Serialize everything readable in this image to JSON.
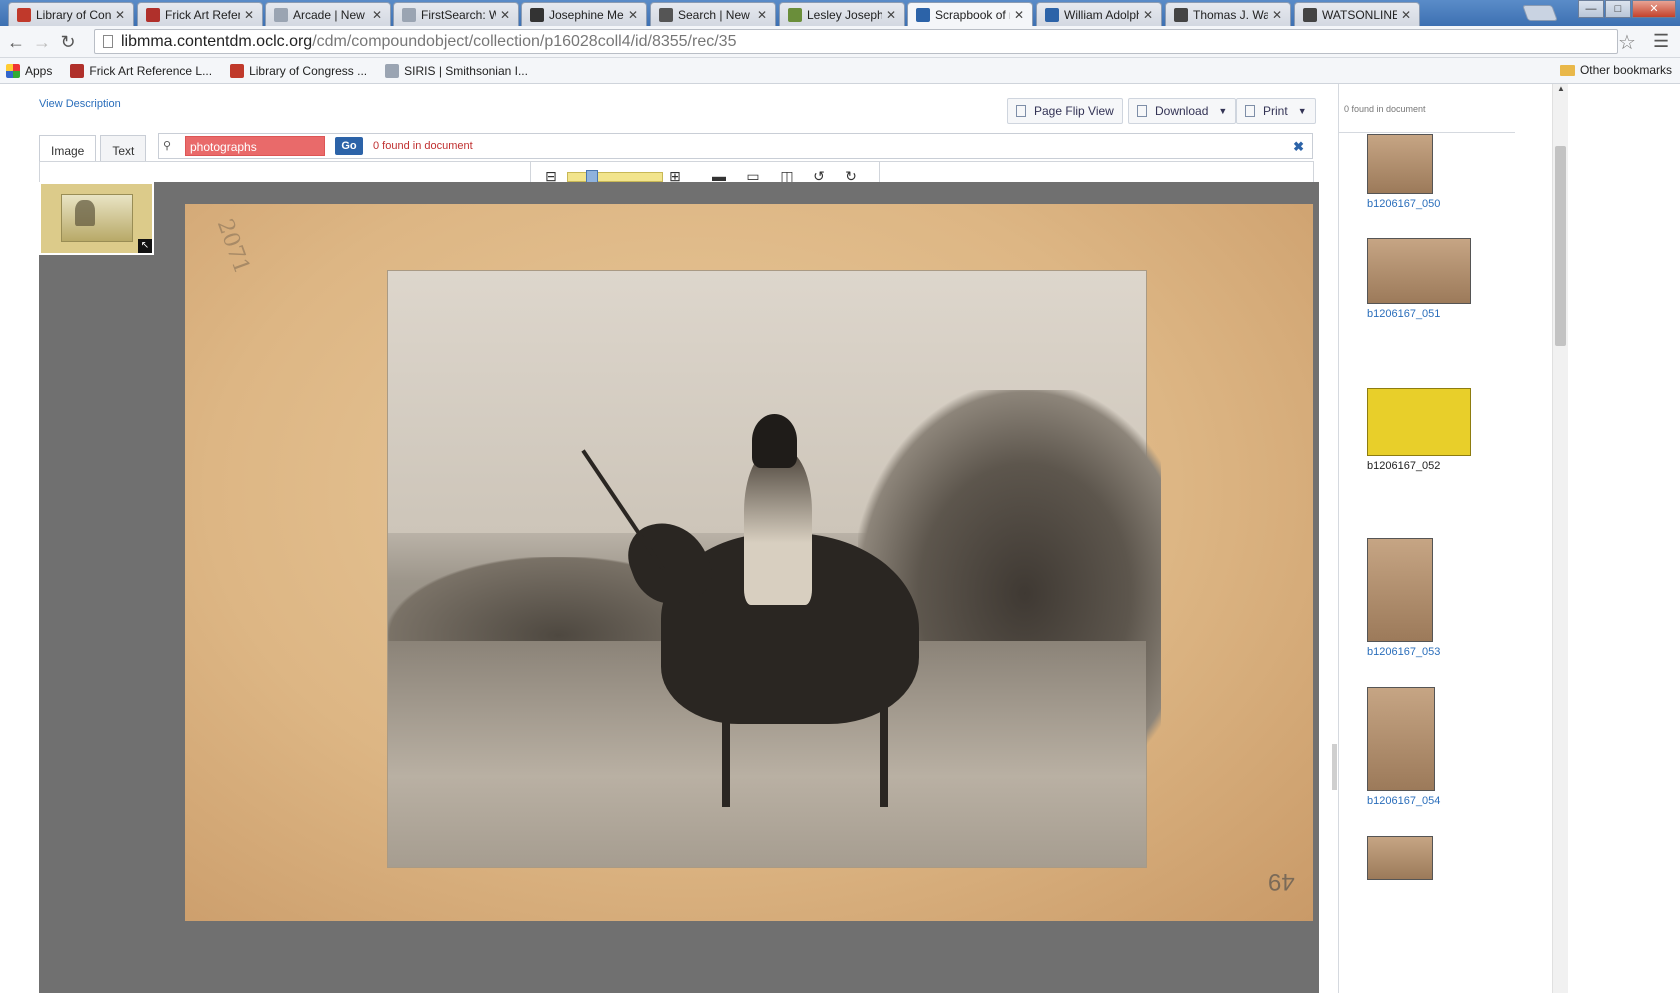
{
  "tabs": [
    {
      "label": "Library of Cong",
      "icon": "library-of-congress-icon",
      "color": "#c0392b",
      "active": false
    },
    {
      "label": "Frick Art Referen",
      "icon": "frick-icon",
      "color": "#b0302b",
      "active": false
    },
    {
      "label": "Arcade | New Yo",
      "icon": "page-icon",
      "color": "#9aa4b2",
      "active": false
    },
    {
      "label": "FirstSearch: Wo",
      "icon": "page-icon",
      "color": "#9aa4b2",
      "active": false
    },
    {
      "label": "Josephine Mell",
      "icon": "book-icon",
      "color": "#333333",
      "active": false
    },
    {
      "label": "Search | New Yo",
      "icon": "search-globe-icon",
      "color": "#555555",
      "active": false
    },
    {
      "label": "Lesley Josephin",
      "icon": "leaf-icon",
      "color": "#6a8e3a",
      "active": false
    },
    {
      "label": "Scrapbook of re",
      "icon": "contentdm-icon",
      "color": "#2c63a8",
      "active": true
    },
    {
      "label": "William Adolph",
      "icon": "worldcat-icon",
      "color": "#2c63a8",
      "active": false
    },
    {
      "label": "Thomas J. Wats",
      "icon": "m-icon",
      "color": "#444444",
      "active": false
    },
    {
      "label": "WATSONLINE: ",
      "icon": "w-icon",
      "color": "#444444",
      "active": false
    }
  ],
  "address": {
    "host": "libmma.contentdm.oclc.org",
    "path": "/cdm/compoundobject/collection/p16028coll4/id/8355/rec/35"
  },
  "bookmarks": {
    "apps": "Apps",
    "items": [
      {
        "label": "Frick Art Reference L...",
        "icon": "frick-icon",
        "color": "#b0302b"
      },
      {
        "label": "Library of Congress ...",
        "icon": "library-of-congress-icon",
        "color": "#c0392b"
      },
      {
        "label": "SIRIS | Smithsonian I...",
        "icon": "page-icon",
        "color": "#9aa4b2"
      }
    ],
    "other": "Other bookmarks"
  },
  "page": {
    "view_description": "View Description",
    "actions": {
      "page_flip": "Page Flip View",
      "download": "Download",
      "print": "Print"
    },
    "view_tabs": {
      "image": "Image",
      "text": "Text"
    },
    "search": {
      "query": "photographs",
      "go": "Go",
      "found": "0 found in document"
    },
    "scan": {
      "pencil_note": "2071",
      "page_number": "49"
    }
  },
  "rpanel": {
    "found": "0 found in document",
    "items": [
      {
        "label": "b1206167_050",
        "selected": false
      },
      {
        "label": "b1206167_051",
        "selected": false
      },
      {
        "label": "b1206167_052",
        "selected": true
      },
      {
        "label": "b1206167_053",
        "selected": false
      },
      {
        "label": "b1206167_054",
        "selected": false
      }
    ]
  },
  "colors": {
    "accent": "#2c63a8",
    "search_highlight": "#e96a6a",
    "selected_thumb": "#e8cf2a"
  }
}
